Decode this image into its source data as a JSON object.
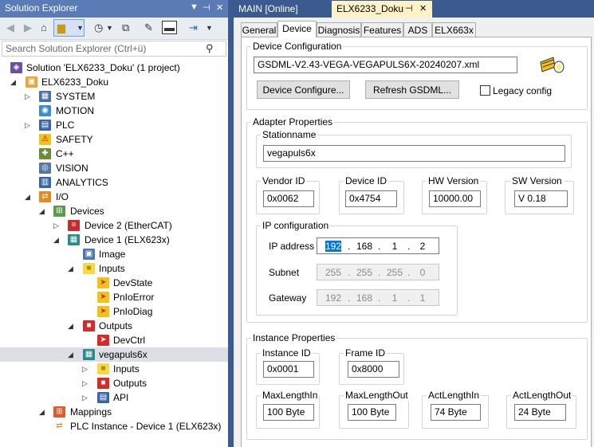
{
  "solution_explorer": {
    "title": "Solution Explorer",
    "title_buttons": [
      "▼",
      "⊣",
      "✕"
    ],
    "search_placeholder": "Search Solution Explorer (Ctrl+ü)",
    "tree": [
      {
        "label": "Solution 'ELX6233_Doku' (1 project)",
        "icon": "solution-icon"
      },
      {
        "label": "ELX6233_Doku",
        "icon": "project-icon"
      },
      {
        "label": "SYSTEM",
        "icon": "system-icon"
      },
      {
        "label": "MOTION",
        "icon": "motion-icon"
      },
      {
        "label": "PLC",
        "icon": "plc-icon"
      },
      {
        "label": "SAFETY",
        "icon": "safety-icon"
      },
      {
        "label": "C++",
        "icon": "cpp-icon"
      },
      {
        "label": "VISION",
        "icon": "vision-icon"
      },
      {
        "label": "ANALYTICS",
        "icon": "analytics-icon"
      },
      {
        "label": "I/O",
        "icon": "io-icon"
      },
      {
        "label": "Devices",
        "icon": "devices-icon"
      },
      {
        "label": "Device 2 (EtherCAT)",
        "icon": "ethercat-icon"
      },
      {
        "label": "Device 1 (ELX623x)",
        "icon": "profinet-icon"
      },
      {
        "label": "Image",
        "icon": "image-icon"
      },
      {
        "label": "Inputs",
        "icon": "inputs-folder-icon"
      },
      {
        "label": "DevState",
        "icon": "input-var-icon"
      },
      {
        "label": "PnIoError",
        "icon": "input-var-icon"
      },
      {
        "label": "PnIoDiag",
        "icon": "input-var-icon"
      },
      {
        "label": "Outputs",
        "icon": "outputs-folder-icon"
      },
      {
        "label": "DevCtrl",
        "icon": "output-var-icon"
      },
      {
        "label": "vegapuls6x",
        "icon": "profinet-device-icon"
      },
      {
        "label": "Inputs",
        "icon": "inputs-folder-icon"
      },
      {
        "label": "Outputs",
        "icon": "outputs-folder-icon"
      },
      {
        "label": "API",
        "icon": "api-icon"
      },
      {
        "label": "Mappings",
        "icon": "mappings-icon"
      },
      {
        "label": "PLC Instance - Device 1 (ELX623x)",
        "icon": "mapping-link-icon"
      }
    ]
  },
  "doc_tabs": {
    "main": "MAIN [Online]",
    "active": "ELX6233_Doku",
    "pin": "⊣",
    "close": "✕"
  },
  "prop_tabs": [
    "General",
    "Device",
    "Diagnosis",
    "Features",
    "ADS",
    "ELX663x"
  ],
  "device_config": {
    "label": "Device Configuration",
    "gsdml": "GSDML-V2.43-VEGA-VEGAPULS6X-20240207.xml",
    "configure_btn": "Device Configure...",
    "refresh_btn": "Refresh GSDML...",
    "legacy_label": "Legacy config",
    "legacy_checked": false
  },
  "adapter": {
    "label": "Adapter Properties",
    "stationname_label": "Stationname",
    "stationname": "vegapuls6x",
    "vendor_id_label": "Vendor ID",
    "vendor_id": "0x0062",
    "device_id_label": "Device ID",
    "device_id": "0x4754",
    "hw_label": "HW Version",
    "hw_version": "10000.00",
    "sw_label": "SW Version",
    "sw_version": "V 0.18",
    "ip_config_label": "IP configuration",
    "ip_label": "IP address",
    "ip": [
      "192",
      "168",
      "1",
      "2"
    ],
    "subnet_label": "Subnet",
    "subnet": [
      "255",
      "255",
      "255",
      "0"
    ],
    "gateway_label": "Gateway",
    "gateway": [
      "192",
      "168",
      "1",
      "1"
    ]
  },
  "instance": {
    "label": "Instance Properties",
    "instance_id_label": "Instance ID",
    "instance_id": "0x0001",
    "frame_id_label": "Frame ID",
    "frame_id": "0x8000",
    "max_in_label": "MaxLengthIn",
    "max_in": "100 Byte",
    "max_out_label": "MaxLengthOut",
    "max_out": "100 Byte",
    "act_in_label": "ActLengthIn",
    "act_in": "74 Byte",
    "act_out_label": "ActLengthOut",
    "act_out": "24 Byte"
  },
  "colors": {
    "title_bar": "#5a7bb5",
    "doc_tab_bar": "#3b5a8f",
    "active_doc_tab": "#fdf3c6",
    "selection": "#0078d7"
  }
}
